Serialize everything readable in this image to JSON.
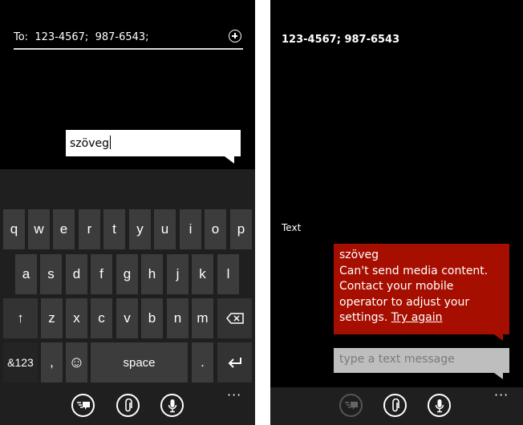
{
  "left": {
    "to_label": "To:",
    "recipients": "123-4567;  987-6543;",
    "compose_text": "szöveg",
    "keyboard": {
      "row1": [
        "q",
        "w",
        "e",
        "r",
        "t",
        "y",
        "u",
        "i",
        "o",
        "p"
      ],
      "row2": [
        "a",
        "s",
        "d",
        "f",
        "g",
        "h",
        "j",
        "k",
        "l"
      ],
      "row3": [
        "z",
        "x",
        "c",
        "v",
        "b",
        "n",
        "m"
      ],
      "symbols": "&123",
      "comma": ",",
      "emoji": "☺",
      "space": "space",
      "period": ".",
      "shift": "↑",
      "enter": "↵"
    },
    "more": "···"
  },
  "right": {
    "recipients": "123-4567; 987-6543",
    "section_label": "Text",
    "message": {
      "title": "szöveg",
      "error_text": "Can't send media content. Contact your mobile operator to adjust your settings.",
      "link": "Try again"
    },
    "input_placeholder": "type a text message",
    "more": "···"
  },
  "colors": {
    "error_bubble": "#a60f00",
    "keyboard_bg": "#1f1f1f",
    "key_bg": "#3c3c3c"
  }
}
